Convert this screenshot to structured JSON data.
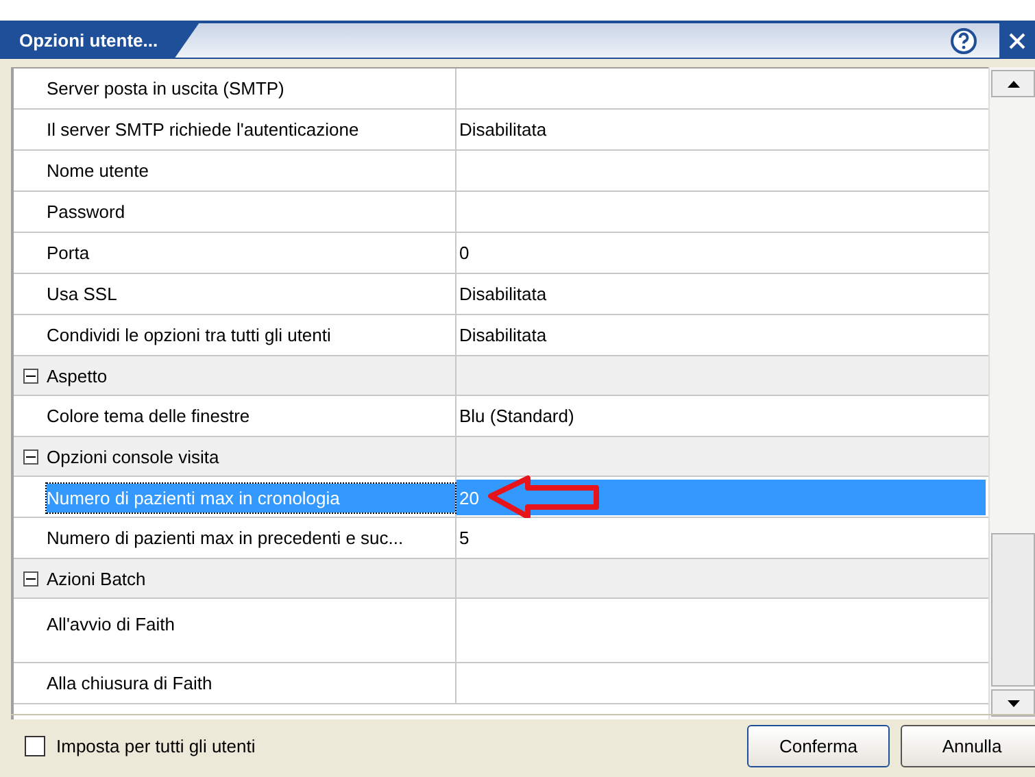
{
  "window": {
    "title": "Opzioni utente..."
  },
  "grid": {
    "rows": [
      {
        "kind": "property",
        "label": "Server posta in uscita (SMTP)",
        "value": "",
        "selected": false
      },
      {
        "kind": "property",
        "label": "Il server SMTP richiede l'autenticazione",
        "value": "Disabilitata",
        "selected": false
      },
      {
        "kind": "property",
        "label": "Nome utente",
        "value": "",
        "selected": false
      },
      {
        "kind": "property",
        "label": "Password",
        "value": "",
        "selected": false
      },
      {
        "kind": "property",
        "label": "Porta",
        "value": "0",
        "selected": false
      },
      {
        "kind": "property",
        "label": "Usa SSL",
        "value": "Disabilitata",
        "selected": false
      },
      {
        "kind": "property",
        "label": "Condividi le opzioni tra tutti gli utenti",
        "value": "Disabilitata",
        "selected": false
      },
      {
        "kind": "category",
        "label": "Aspetto",
        "expanded": true
      },
      {
        "kind": "property",
        "label": "Colore tema delle finestre",
        "value": "Blu (Standard)",
        "selected": false
      },
      {
        "kind": "category",
        "label": "Opzioni console visita",
        "expanded": true
      },
      {
        "kind": "property",
        "label": "Numero di pazienti max in cronologia",
        "value": "20",
        "selected": true
      },
      {
        "kind": "property",
        "label": "Numero di pazienti max in precedenti e suc...",
        "value": "5",
        "selected": false
      },
      {
        "kind": "category",
        "label": "Azioni Batch",
        "expanded": true
      },
      {
        "kind": "tall",
        "label": "All'avvio di Faith",
        "value": "",
        "selected": false
      },
      {
        "kind": "property",
        "label": "Alla chiusura di Faith",
        "value": "",
        "selected": false
      }
    ]
  },
  "apply_all": {
    "label": "Imposta per tutti gli utenti",
    "checked": false
  },
  "buttons": [
    {
      "label": "Conferma",
      "kind": "default"
    },
    {
      "label": "Annulla",
      "kind": "normal"
    }
  ]
}
